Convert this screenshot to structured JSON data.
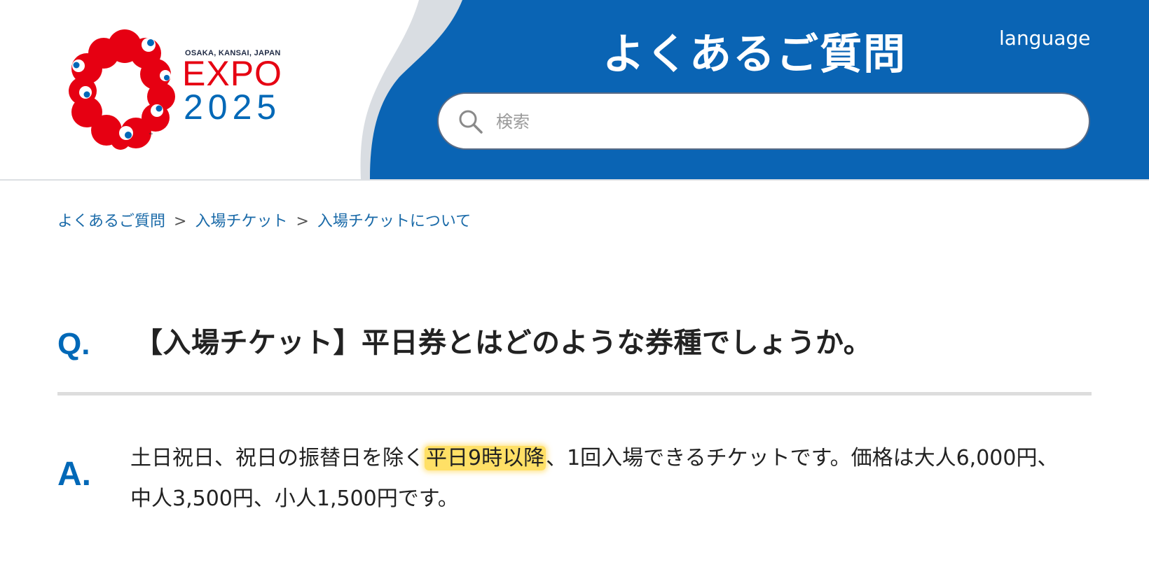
{
  "header": {
    "logo": {
      "subtitle": "OSAKA, KANSAI, JAPAN",
      "word": "EXPO",
      "year": "2025",
      "tm": "™"
    },
    "title": "よくあるご質問",
    "language_label": "language",
    "search": {
      "placeholder": "検索",
      "value": ""
    }
  },
  "breadcrumb": {
    "items": [
      "よくあるご質問",
      "入場チケット",
      "入場チケットについて"
    ],
    "separator": ">"
  },
  "faq": {
    "q_label": "Q.",
    "question": "【入場チケット】平日券とはどのような券種でしょうか。",
    "a_label": "A.",
    "answer_before": "土日祝日、祝日の振替日を除く",
    "answer_highlight": "平日9時以降",
    "answer_after": "、1回入場できるチケットです。価格は大人6,000円、中人3,500円、小人1,500円です。"
  },
  "colors": {
    "brand_blue": "#0068b7",
    "brand_red": "#e60012",
    "header_blue": "#0a64b4",
    "highlight": "#ffe066",
    "link": "#1a6aa8"
  }
}
